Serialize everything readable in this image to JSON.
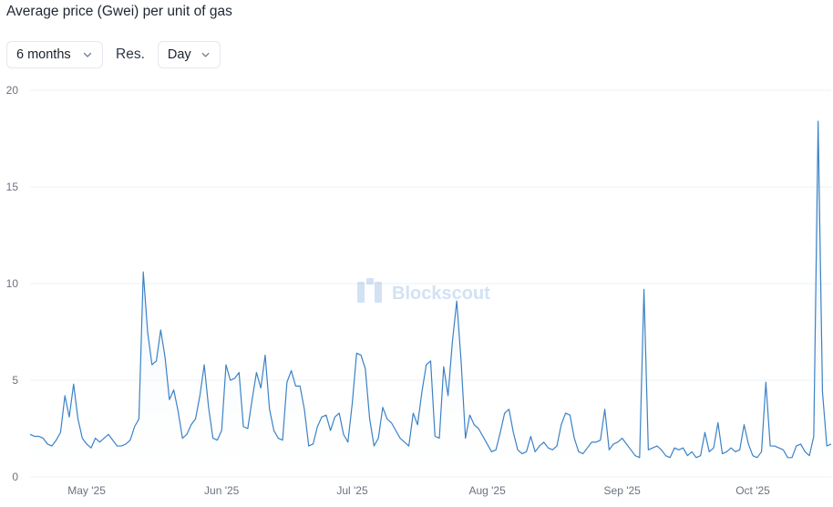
{
  "header": {
    "title": "Average price (Gwei) per unit of gas"
  },
  "controls": {
    "period": {
      "selected": "6 months",
      "icon": "chevron-down-icon"
    },
    "resolution_label": "Res.",
    "resolution": {
      "selected": "Day",
      "icon": "chevron-down-icon"
    }
  },
  "watermark": {
    "text": "Blockscout",
    "icon": "blockscout-logo"
  },
  "colors": {
    "line": "#3b82c6",
    "grid": "#edf0f3",
    "fill_top": "#d6e7f7"
  },
  "chart_data": {
    "type": "area",
    "title": "Average price (Gwei) per unit of gas",
    "xlabel": "",
    "ylabel": "",
    "xlim": [
      "2025-04-18",
      "2025-10-19"
    ],
    "ylim": [
      0,
      20
    ],
    "yticks": [
      0,
      5,
      10,
      15,
      20
    ],
    "xticks": [
      {
        "date": "2025-05-01",
        "label": "May '25"
      },
      {
        "date": "2025-06-01",
        "label": "Jun '25"
      },
      {
        "date": "2025-07-01",
        "label": "Jul '25"
      },
      {
        "date": "2025-08-01",
        "label": "Aug '25"
      },
      {
        "date": "2025-09-01",
        "label": "Sep '25"
      },
      {
        "date": "2025-10-01",
        "label": "Oct '25"
      }
    ],
    "grid": true,
    "legend": "none",
    "series": [
      {
        "values": [
          [
            "2025-04-18",
            2.2
          ],
          [
            "2025-04-19",
            2.1
          ],
          [
            "2025-04-20",
            2.1
          ],
          [
            "2025-04-21",
            2.0
          ],
          [
            "2025-04-22",
            1.7
          ],
          [
            "2025-04-23",
            1.6
          ],
          [
            "2025-04-24",
            1.9
          ],
          [
            "2025-04-25",
            2.3
          ],
          [
            "2025-04-26",
            4.2
          ],
          [
            "2025-04-27",
            3.1
          ],
          [
            "2025-04-28",
            4.8
          ],
          [
            "2025-04-29",
            3.0
          ],
          [
            "2025-04-30",
            2.0
          ],
          [
            "2025-05-01",
            1.7
          ],
          [
            "2025-05-02",
            1.5
          ],
          [
            "2025-05-03",
            2.0
          ],
          [
            "2025-05-04",
            1.8
          ],
          [
            "2025-05-05",
            2.0
          ],
          [
            "2025-05-06",
            2.2
          ],
          [
            "2025-05-07",
            1.9
          ],
          [
            "2025-05-08",
            1.6
          ],
          [
            "2025-05-09",
            1.6
          ],
          [
            "2025-05-10",
            1.7
          ],
          [
            "2025-05-11",
            1.9
          ],
          [
            "2025-05-12",
            2.6
          ],
          [
            "2025-05-13",
            3.0
          ],
          [
            "2025-05-14",
            10.6
          ],
          [
            "2025-05-15",
            7.5
          ],
          [
            "2025-05-16",
            5.8
          ],
          [
            "2025-05-17",
            6.0
          ],
          [
            "2025-05-18",
            7.6
          ],
          [
            "2025-05-19",
            6.2
          ],
          [
            "2025-05-20",
            4.0
          ],
          [
            "2025-05-21",
            4.5
          ],
          [
            "2025-05-22",
            3.4
          ],
          [
            "2025-05-23",
            2.0
          ],
          [
            "2025-05-24",
            2.2
          ],
          [
            "2025-05-25",
            2.7
          ],
          [
            "2025-05-26",
            3.0
          ],
          [
            "2025-05-27",
            4.2
          ],
          [
            "2025-05-28",
            5.8
          ],
          [
            "2025-05-29",
            3.6
          ],
          [
            "2025-05-30",
            2.0
          ],
          [
            "2025-05-31",
            1.9
          ],
          [
            "2025-06-01",
            2.4
          ],
          [
            "2025-06-02",
            5.8
          ],
          [
            "2025-06-03",
            5.0
          ],
          [
            "2025-06-04",
            5.1
          ],
          [
            "2025-06-05",
            5.4
          ],
          [
            "2025-06-06",
            2.6
          ],
          [
            "2025-06-07",
            2.5
          ],
          [
            "2025-06-08",
            4.0
          ],
          [
            "2025-06-09",
            5.4
          ],
          [
            "2025-06-10",
            4.6
          ],
          [
            "2025-06-11",
            6.3
          ],
          [
            "2025-06-12",
            3.5
          ],
          [
            "2025-06-13",
            2.4
          ],
          [
            "2025-06-14",
            2.0
          ],
          [
            "2025-06-15",
            1.9
          ],
          [
            "2025-06-16",
            4.9
          ],
          [
            "2025-06-17",
            5.5
          ],
          [
            "2025-06-18",
            4.7
          ],
          [
            "2025-06-19",
            4.7
          ],
          [
            "2025-06-20",
            3.5
          ],
          [
            "2025-06-21",
            1.6
          ],
          [
            "2025-06-22",
            1.7
          ],
          [
            "2025-06-23",
            2.6
          ],
          [
            "2025-06-24",
            3.1
          ],
          [
            "2025-06-25",
            3.2
          ],
          [
            "2025-06-26",
            2.4
          ],
          [
            "2025-06-27",
            3.1
          ],
          [
            "2025-06-28",
            3.3
          ],
          [
            "2025-06-29",
            2.2
          ],
          [
            "2025-06-30",
            1.8
          ],
          [
            "2025-07-01",
            3.8
          ],
          [
            "2025-07-02",
            6.4
          ],
          [
            "2025-07-03",
            6.3
          ],
          [
            "2025-07-04",
            5.6
          ],
          [
            "2025-07-05",
            3.0
          ],
          [
            "2025-07-06",
            1.6
          ],
          [
            "2025-07-07",
            2.0
          ],
          [
            "2025-07-08",
            3.6
          ],
          [
            "2025-07-09",
            3.0
          ],
          [
            "2025-07-10",
            2.8
          ],
          [
            "2025-07-11",
            2.4
          ],
          [
            "2025-07-12",
            2.0
          ],
          [
            "2025-07-13",
            1.8
          ],
          [
            "2025-07-14",
            1.6
          ],
          [
            "2025-07-15",
            3.3
          ],
          [
            "2025-07-16",
            2.7
          ],
          [
            "2025-07-17",
            4.4
          ],
          [
            "2025-07-18",
            5.8
          ],
          [
            "2025-07-19",
            6.0
          ],
          [
            "2025-07-20",
            2.1
          ],
          [
            "2025-07-21",
            2.0
          ],
          [
            "2025-07-22",
            5.7
          ],
          [
            "2025-07-23",
            4.2
          ],
          [
            "2025-07-24",
            7.0
          ],
          [
            "2025-07-25",
            9.1
          ],
          [
            "2025-07-26",
            6.0
          ],
          [
            "2025-07-27",
            2.0
          ],
          [
            "2025-07-28",
            3.2
          ],
          [
            "2025-07-29",
            2.7
          ],
          [
            "2025-07-30",
            2.5
          ],
          [
            "2025-07-31",
            2.1
          ],
          [
            "2025-08-01",
            1.7
          ],
          [
            "2025-08-02",
            1.3
          ],
          [
            "2025-08-03",
            1.4
          ],
          [
            "2025-08-04",
            2.3
          ],
          [
            "2025-08-05",
            3.3
          ],
          [
            "2025-08-06",
            3.5
          ],
          [
            "2025-08-07",
            2.3
          ],
          [
            "2025-08-08",
            1.4
          ],
          [
            "2025-08-09",
            1.2
          ],
          [
            "2025-08-10",
            1.3
          ],
          [
            "2025-08-11",
            2.1
          ],
          [
            "2025-08-12",
            1.3
          ],
          [
            "2025-08-13",
            1.6
          ],
          [
            "2025-08-14",
            1.8
          ],
          [
            "2025-08-15",
            1.5
          ],
          [
            "2025-08-16",
            1.4
          ],
          [
            "2025-08-17",
            1.6
          ],
          [
            "2025-08-18",
            2.7
          ],
          [
            "2025-08-19",
            3.3
          ],
          [
            "2025-08-20",
            3.2
          ],
          [
            "2025-08-21",
            2.0
          ],
          [
            "2025-08-22",
            1.3
          ],
          [
            "2025-08-23",
            1.2
          ],
          [
            "2025-08-24",
            1.5
          ],
          [
            "2025-08-25",
            1.8
          ],
          [
            "2025-08-26",
            1.8
          ],
          [
            "2025-08-27",
            1.9
          ],
          [
            "2025-08-28",
            3.5
          ],
          [
            "2025-08-29",
            1.4
          ],
          [
            "2025-08-30",
            1.7
          ],
          [
            "2025-08-31",
            1.8
          ],
          [
            "2025-09-01",
            2.0
          ],
          [
            "2025-09-02",
            1.7
          ],
          [
            "2025-09-03",
            1.4
          ],
          [
            "2025-09-04",
            1.1
          ],
          [
            "2025-09-05",
            1.0
          ],
          [
            "2025-09-06",
            9.7
          ],
          [
            "2025-09-07",
            1.4
          ],
          [
            "2025-09-08",
            1.5
          ],
          [
            "2025-09-09",
            1.6
          ],
          [
            "2025-09-10",
            1.4
          ],
          [
            "2025-09-11",
            1.1
          ],
          [
            "2025-09-12",
            1.0
          ],
          [
            "2025-09-13",
            1.5
          ],
          [
            "2025-09-14",
            1.4
          ],
          [
            "2025-09-15",
            1.5
          ],
          [
            "2025-09-16",
            1.1
          ],
          [
            "2025-09-17",
            1.3
          ],
          [
            "2025-09-18",
            1.0
          ],
          [
            "2025-09-19",
            1.1
          ],
          [
            "2025-09-20",
            2.3
          ],
          [
            "2025-09-21",
            1.3
          ],
          [
            "2025-09-22",
            1.5
          ],
          [
            "2025-09-23",
            2.8
          ],
          [
            "2025-09-24",
            1.2
          ],
          [
            "2025-09-25",
            1.3
          ],
          [
            "2025-09-26",
            1.5
          ],
          [
            "2025-09-27",
            1.3
          ],
          [
            "2025-09-28",
            1.4
          ],
          [
            "2025-09-29",
            2.7
          ],
          [
            "2025-09-30",
            1.7
          ],
          [
            "2025-10-01",
            1.1
          ],
          [
            "2025-10-02",
            1.0
          ],
          [
            "2025-10-03",
            1.3
          ],
          [
            "2025-10-04",
            4.9
          ],
          [
            "2025-10-05",
            1.6
          ],
          [
            "2025-10-06",
            1.6
          ],
          [
            "2025-10-07",
            1.5
          ],
          [
            "2025-10-08",
            1.4
          ],
          [
            "2025-10-09",
            1.0
          ],
          [
            "2025-10-10",
            1.0
          ],
          [
            "2025-10-11",
            1.6
          ],
          [
            "2025-10-12",
            1.7
          ],
          [
            "2025-10-13",
            1.3
          ],
          [
            "2025-10-14",
            1.1
          ],
          [
            "2025-10-15",
            2.1
          ],
          [
            "2025-10-16",
            18.4
          ],
          [
            "2025-10-17",
            4.4
          ],
          [
            "2025-10-18",
            1.6
          ],
          [
            "2025-10-19",
            1.7
          ]
        ]
      }
    ]
  }
}
